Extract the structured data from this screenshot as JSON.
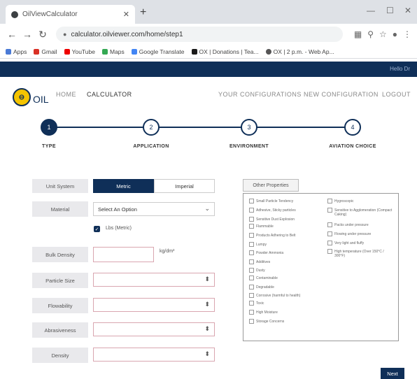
{
  "browser": {
    "tab_title": "OilViewCalculator",
    "url": "calculator.oilviewer.com/home/step1",
    "bookmarks": [
      "Apps",
      "Gmail",
      "YouTube",
      "Maps",
      "Google Translate",
      "OX | Donations | Tea...",
      "OX | 2 p.m. - Web Ap..."
    ]
  },
  "header": {
    "greeting": "Hello Dr",
    "logo_text": "OIL",
    "nav": [
      "HOME",
      "CALCULATOR",
      "YOUR CONFIGURATIONS",
      "NEW CONFIGURATION",
      "LOGOUT"
    ]
  },
  "stepper": {
    "steps": [
      {
        "num": "1",
        "label": "TYPE",
        "active": true
      },
      {
        "num": "2",
        "label": "APPLICATION",
        "active": false
      },
      {
        "num": "3",
        "label": "ENVIRONMENT",
        "active": false
      },
      {
        "num": "4",
        "label": "AVIATION CHOICE",
        "active": false
      }
    ]
  },
  "form": {
    "unit_system_label": "Unit System",
    "unit_options": [
      "Metric",
      "Imperial"
    ],
    "material_label": "Material",
    "material_value": "Select An Option",
    "checkbox_label": "Lbs (Metric)",
    "bulk_density_label": "Bulk Density",
    "bulk_density_unit": "kg/dm³",
    "particle_size_label": "Particle Size",
    "flowability_label": "Flowability",
    "abrasiveness_label": "Abrasiveness",
    "density_label": "Density"
  },
  "filter": {
    "tab_label": "Other Properties",
    "col1": [
      "Small Particle Tendency",
      "Adhesive, Sticky particles",
      "Sensitive Dust Explosion",
      "Flammable",
      "Products Adhering to Belt",
      "Lumpy",
      "Powder Ammonia",
      "Additives",
      "Dusty",
      "Contaminable",
      "Degradable",
      "Corrosive (harmful to health)",
      "Toxic",
      "High Moisture",
      "Storage Concerns"
    ],
    "col2": [
      "Hygroscopic",
      "Sensitive to Agglomeration (Compact Caking)",
      "Packs under pressure",
      "Flowing under pressure",
      "Very light and fluffy",
      "High temperature (Over 150°C / 300°F)"
    ]
  },
  "actions": {
    "next_label": "Next"
  },
  "colors": {
    "brand_navy": "#0f2f58",
    "brand_yellow": "#f4c400"
  }
}
